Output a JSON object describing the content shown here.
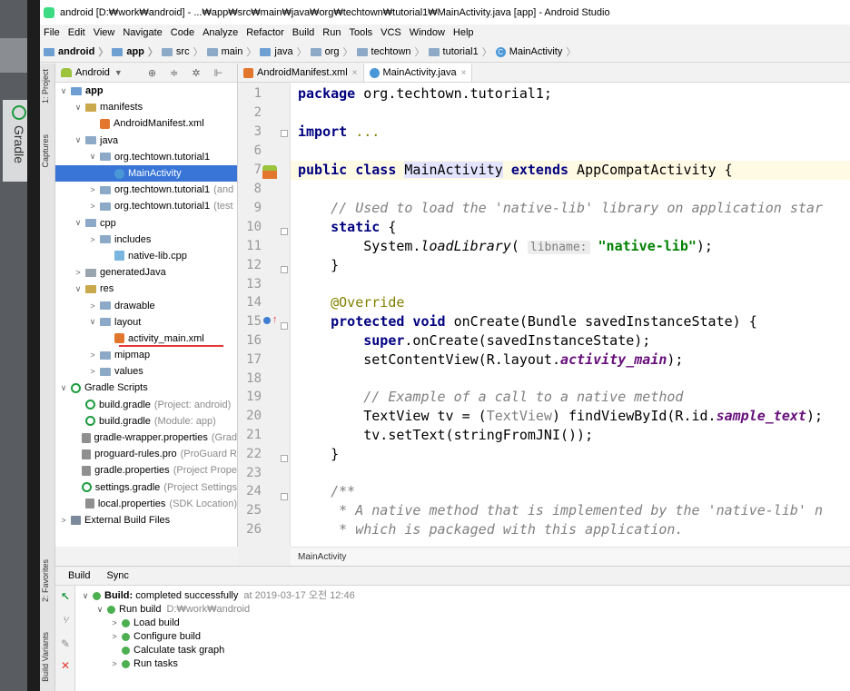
{
  "window": {
    "title": "android [D:₩work₩android] - ...₩app₩src₩main₩java₩org₩techtown₩tutorial1₩MainActivity.java [app] - Android Studio"
  },
  "menu": [
    "File",
    "Edit",
    "View",
    "Navigate",
    "Code",
    "Analyze",
    "Refactor",
    "Build",
    "Run",
    "Tools",
    "VCS",
    "Window",
    "Help"
  ],
  "breadcrumb": [
    "android",
    "app",
    "src",
    "main",
    "java",
    "org",
    "techtown",
    "tutorial1",
    "MainActivity"
  ],
  "left_strip": {
    "gradle": "Gradle"
  },
  "side_tabs": {
    "project": "1: Project",
    "captures": "Captures",
    "favorites": "2: Favorites",
    "build_variants": "Build Variants"
  },
  "project_panel": {
    "view_label": "Android",
    "tree": [
      {
        "label": "app",
        "hint": ""
      },
      {
        "label": "manifests",
        "hint": ""
      },
      {
        "label": "AndroidManifest.xml",
        "hint": ""
      },
      {
        "label": "java",
        "hint": ""
      },
      {
        "label": "org.techtown.tutorial1",
        "hint": ""
      },
      {
        "label": "MainActivity",
        "hint": ""
      },
      {
        "label": "org.techtown.tutorial1",
        "hint": "(and"
      },
      {
        "label": "org.techtown.tutorial1",
        "hint": "(test"
      },
      {
        "label": "cpp",
        "hint": ""
      },
      {
        "label": "includes",
        "hint": ""
      },
      {
        "label": "native-lib.cpp",
        "hint": ""
      },
      {
        "label": "generatedJava",
        "hint": ""
      },
      {
        "label": "res",
        "hint": ""
      },
      {
        "label": "drawable",
        "hint": ""
      },
      {
        "label": "layout",
        "hint": ""
      },
      {
        "label": "activity_main.xml",
        "hint": ""
      },
      {
        "label": "mipmap",
        "hint": ""
      },
      {
        "label": "values",
        "hint": ""
      },
      {
        "label": "Gradle Scripts",
        "hint": ""
      },
      {
        "label": "build.gradle",
        "hint": "(Project: android)"
      },
      {
        "label": "build.gradle",
        "hint": "(Module: app)"
      },
      {
        "label": "gradle-wrapper.properties",
        "hint": "(Grad"
      },
      {
        "label": "proguard-rules.pro",
        "hint": "(ProGuard R"
      },
      {
        "label": "gradle.properties",
        "hint": "(Project Prope"
      },
      {
        "label": "settings.gradle",
        "hint": "(Project Settings"
      },
      {
        "label": "local.properties",
        "hint": "(SDK Location)"
      },
      {
        "label": "External Build Files",
        "hint": ""
      }
    ]
  },
  "editor": {
    "tabs": [
      "AndroidManifest.xml",
      "MainActivity.java"
    ],
    "line_numbers": [
      "1",
      "2",
      "3",
      "6",
      "7",
      "8",
      "9",
      "10",
      "11",
      "12",
      "13",
      "14",
      "15",
      "16",
      "17",
      "18",
      "19",
      "20",
      "21",
      "22",
      "23",
      "24",
      "25",
      "26"
    ],
    "code": {
      "l1_kw": "package",
      "l1_rest": " org.techtown.tutorial1;",
      "l3_kw": "import",
      "l3_rest": " ...",
      "l7_kw1": "public class",
      "l7_cls": "MainActivity",
      "l7_kw2": "extends",
      "l7_rest": " AppCompatActivity {",
      "l9": "    // Used to load the 'native-lib' library on application star",
      "l10_kw": "static",
      "l10_rest": " {",
      "l11_a": "        System.",
      "l11_m": "loadLibrary",
      "l11_b": "( ",
      "l11_hint": "libname:",
      "l11_str": "\"native-lib\"",
      "l11_c": ");",
      "l12": "    }",
      "l14": "    @Override",
      "l15_kw": "protected void",
      "l15_rest": " onCreate(Bundle savedInstanceState) {",
      "l16_kw": "super",
      "l16_rest": ".onCreate(savedInstanceState);",
      "l17_a": "        setContentView(R.layout.",
      "l17_f": "activity_main",
      "l17_b": ");",
      "l19": "        // Example of a call to a native method",
      "l20_a": "        TextView tv = (",
      "l20_g": "TextView",
      "l20_b": ") findViewById(R.id.",
      "l20_f": "sample_text",
      "l20_c": ");",
      "l21": "        tv.setText(stringFromJNI());",
      "l22": "    }",
      "l24": "    /**",
      "l25": "     * A native method that is implemented by the 'native-lib' n",
      "l26": "     * which is packaged with this application."
    },
    "footer_crumb": "MainActivity"
  },
  "build_panel": {
    "tabs": [
      "Build",
      "Sync"
    ],
    "rows": [
      {
        "label": "Build:",
        "detail": "completed successfully",
        "meta": "at 2019-03-17 오전 12:46"
      },
      {
        "label": "Run build",
        "meta": "D:₩work₩android"
      },
      {
        "label": "Load build"
      },
      {
        "label": "Configure build"
      },
      {
        "label": "Calculate task graph"
      },
      {
        "label": "Run tasks"
      }
    ]
  },
  "colors": {
    "selection": "#3875d7",
    "keyword": "#000080",
    "string": "#008000",
    "comment": "#808080",
    "underline": "#e53935"
  }
}
